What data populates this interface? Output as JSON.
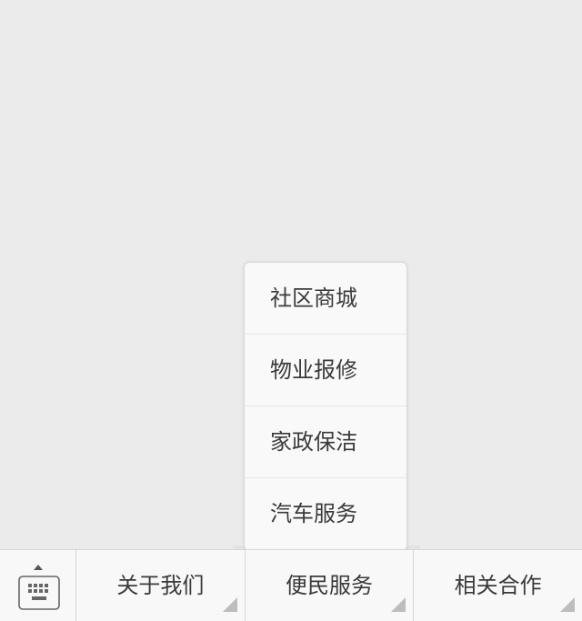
{
  "submenu": {
    "items": [
      {
        "label": "社区商城"
      },
      {
        "label": "物业报修"
      },
      {
        "label": "家政保洁"
      },
      {
        "label": "汽车服务"
      }
    ]
  },
  "menubar": {
    "keyboard_icon": "keyboard-icon",
    "buttons": [
      {
        "label": "关于我们"
      },
      {
        "label": "便民服务"
      },
      {
        "label": "相关合作"
      }
    ]
  },
  "colors": {
    "background": "#ebebeb",
    "menubar": "#f8f8f8",
    "text": "#3a3a3a"
  }
}
